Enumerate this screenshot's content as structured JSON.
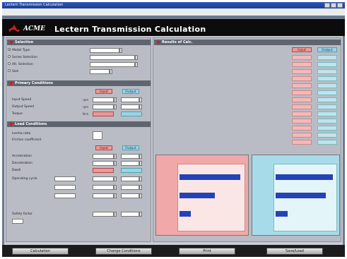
{
  "window": {
    "title": "Lectern Transmission Calculation"
  },
  "banner": {
    "brand": "ACME",
    "title": "Lectern Transmission Calculation"
  },
  "left": {
    "sect1": "Selection",
    "rows1": [
      {
        "label": "Model Type",
        "value": "",
        "selected": true
      },
      {
        "label": "Series Selection",
        "value": "",
        "selected": false
      },
      {
        "label": "Alt. Selection",
        "value": "",
        "selected": false
      },
      {
        "label": "Size",
        "value": "",
        "selected": false
      }
    ],
    "sect2": "Primary Conditions",
    "hdr2": {
      "red": "Input",
      "blue": "Output"
    },
    "rows2": [
      {
        "label": "Input Speed",
        "unit": "rpm"
      },
      {
        "label": "Output Speed",
        "unit": "rpm"
      },
      {
        "label": "Torque",
        "unit": "N·m"
      }
    ],
    "sect3": "Load Conditions",
    "rows3": [
      {
        "label": "Inertia ratio",
        "unit": ""
      },
      {
        "label": "Friction coefficient",
        "unit": ""
      }
    ],
    "hdr3": {
      "red": "Input",
      "blue": "Output"
    },
    "rows4": [
      {
        "label": "Acceleration",
        "unit": ""
      },
      {
        "label": "Deceleration",
        "unit": ""
      },
      {
        "label": "Dwell",
        "unit": ""
      },
      {
        "label": "Operating cycle",
        "unit": ""
      },
      {
        "label": "",
        "unit": ""
      },
      {
        "label": "",
        "unit": ""
      }
    ],
    "rows5": [
      {
        "label": "Safety factor",
        "unit": ""
      }
    ]
  },
  "right": {
    "sect": "Results of Calc.",
    "hdr": {
      "red": "Input",
      "blue": "Output"
    },
    "rows": [
      {
        "label": "",
        "a": "",
        "b": ""
      },
      {
        "label": "",
        "a": "",
        "b": ""
      },
      {
        "label": "",
        "a": "",
        "b": ""
      },
      {
        "label": "",
        "a": "",
        "b": ""
      },
      {
        "label": "",
        "a": "",
        "b": ""
      },
      {
        "label": "",
        "a": "",
        "b": ""
      },
      {
        "label": "",
        "a": "",
        "b": ""
      },
      {
        "label": "",
        "a": "",
        "b": ""
      },
      {
        "label": "",
        "a": "",
        "b": ""
      },
      {
        "label": "",
        "a": "",
        "b": ""
      },
      {
        "label": "",
        "a": "",
        "b": ""
      },
      {
        "label": "",
        "a": "",
        "b": ""
      },
      {
        "label": "",
        "a": "",
        "b": ""
      }
    ],
    "chart_red": {
      "bars": [
        {
          "label": "",
          "value": 0.95
        },
        {
          "label": "",
          "value": 0.55
        },
        {
          "label": "",
          "value": 0.18
        }
      ]
    },
    "chart_blue": {
      "bars": [
        {
          "label": "",
          "value": 0.97
        },
        {
          "label": "",
          "value": 0.85
        },
        {
          "label": "",
          "value": 0.2
        }
      ]
    }
  },
  "footer": {
    "buttons": [
      "Calculation",
      "Change Conditions",
      "Print",
      "Save/Load"
    ]
  },
  "colors": {
    "accent_red": "#d21d1d",
    "panel_red": "#f1a8a8",
    "panel_blue": "#a8dbea",
    "bar_blue": "#2443b7"
  }
}
